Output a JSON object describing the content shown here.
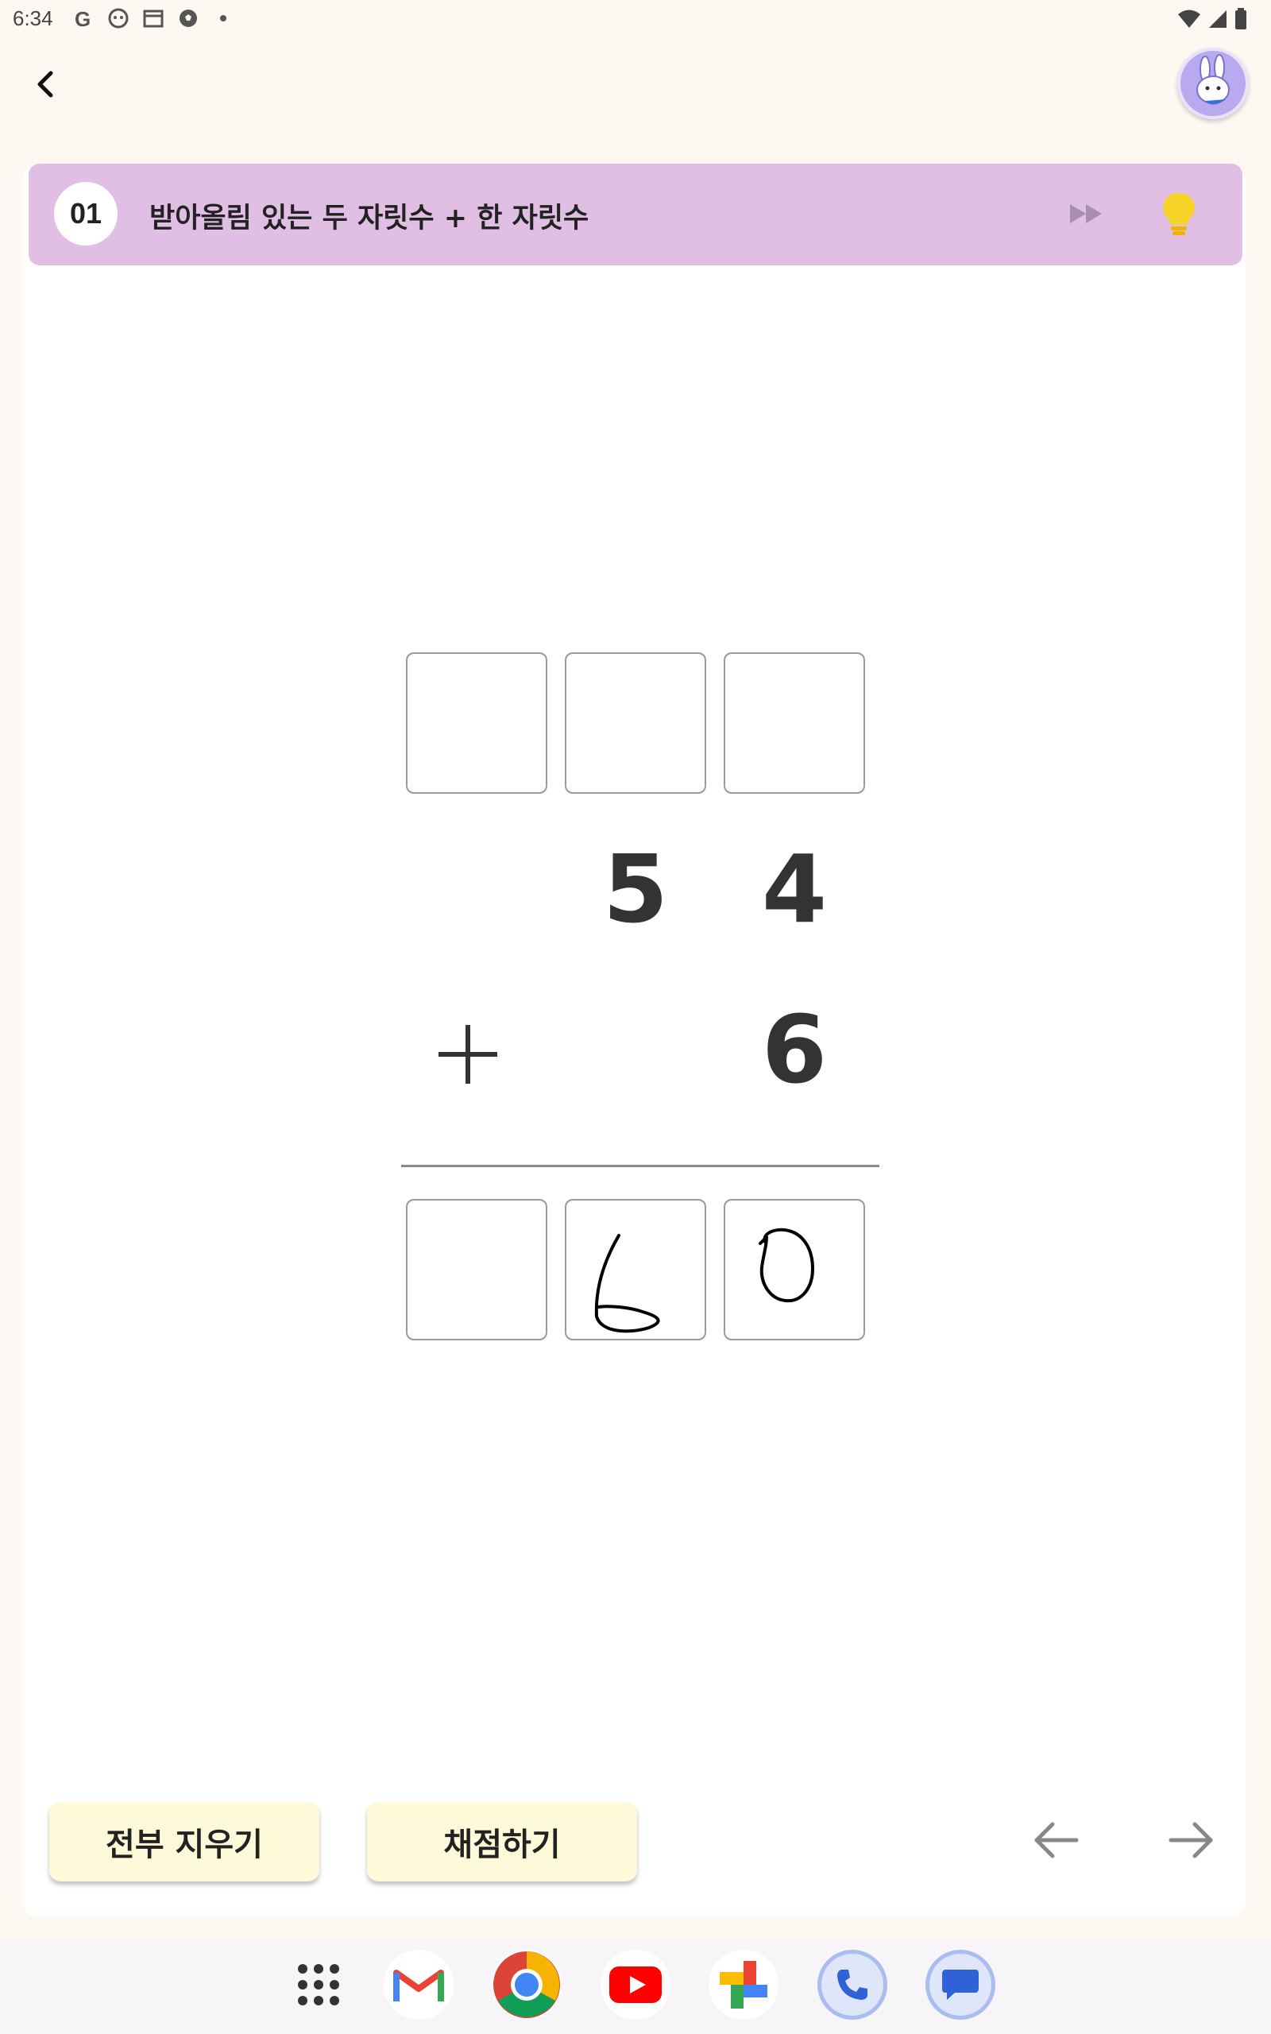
{
  "status_bar": {
    "time": "6:34",
    "left_icons": [
      "google-icon",
      "face-icon",
      "calendar-icon",
      "soccer-ball-icon",
      "dot-icon"
    ],
    "right_icons": [
      "wifi-icon",
      "signal-icon",
      "battery-icon"
    ]
  },
  "header": {
    "back_icon": "chevron-left-icon",
    "avatar": "bunny-avatar"
  },
  "problem_title": {
    "number": "01",
    "text": "받아올림 있는 두 자릿수 + 한 자릿수",
    "skip_icon": "fast-forward-icon",
    "hint_icon": "lightbulb-icon"
  },
  "problem": {
    "top_row_boxes": [
      "",
      "",
      ""
    ],
    "addend1": {
      "tens": "5",
      "ones": "4"
    },
    "operator": "+",
    "addend2": {
      "ones": "6"
    },
    "answer_boxes": [
      "",
      "6",
      "0"
    ],
    "answer_is_handwritten": true
  },
  "actions": {
    "clear_all": "전부 지우기",
    "grade": "채점하기",
    "prev_icon": "arrow-left-icon",
    "next_icon": "arrow-right-icon"
  },
  "dock": {
    "apps": [
      "app-drawer-icon",
      "gmail-icon",
      "chrome-icon",
      "youtube-icon",
      "photos-icon",
      "phone-icon",
      "messages-icon"
    ]
  },
  "colors": {
    "background": "#fdf8f2",
    "title_bar": "#e1bfe5",
    "button": "#fdf9d9",
    "hint": "#f7d227"
  }
}
